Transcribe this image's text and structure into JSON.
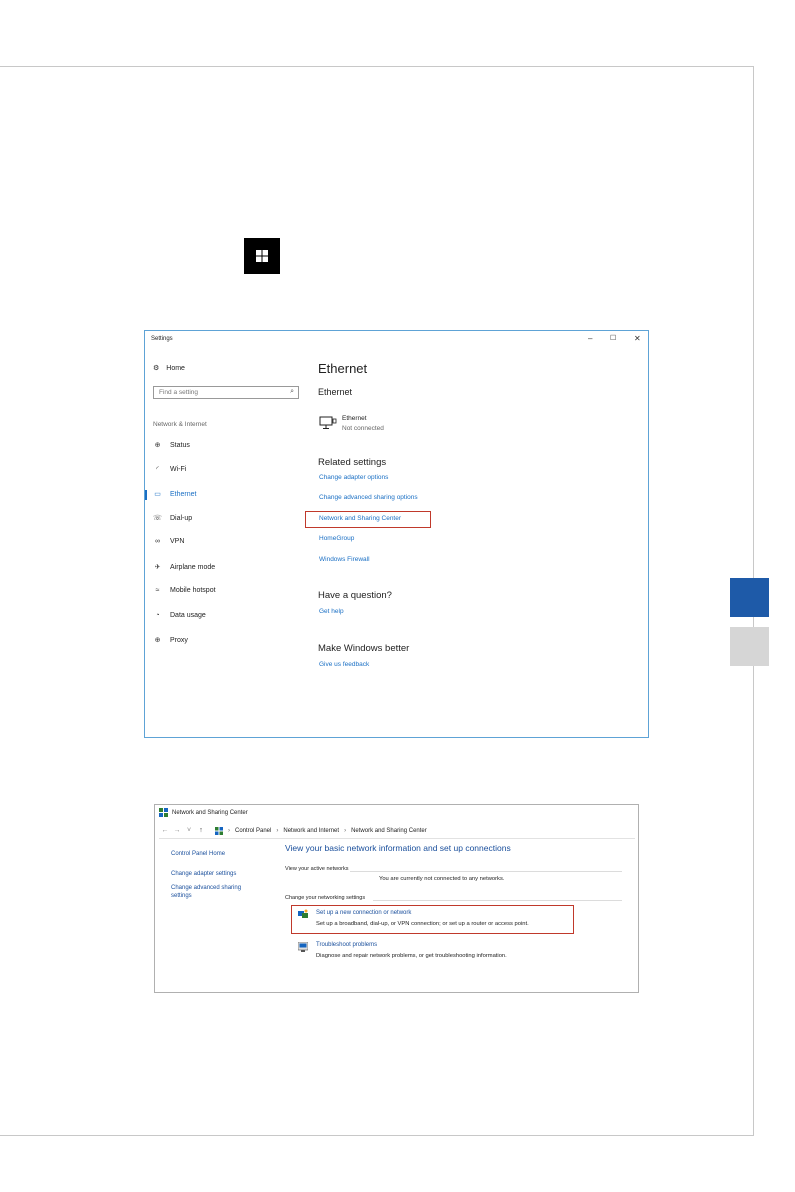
{
  "settings_window": {
    "title": "Settings",
    "controls": {
      "minimize": "–",
      "maximize": "☐",
      "close": "✕"
    },
    "home_label": "Home",
    "search_placeholder": "Find a setting",
    "section_label": "Network & Internet",
    "nav_items": [
      {
        "label": "Status",
        "icon": "status-icon"
      },
      {
        "label": "Wi-Fi",
        "icon": "wifi-icon"
      },
      {
        "label": "Ethernet",
        "icon": "ethernet-icon",
        "active": true
      },
      {
        "label": "Dial-up",
        "icon": "dialup-icon"
      },
      {
        "label": "VPN",
        "icon": "vpn-icon"
      },
      {
        "label": "Airplane mode",
        "icon": "airplane-icon"
      },
      {
        "label": "Mobile hotspot",
        "icon": "hotspot-icon"
      },
      {
        "label": "Data usage",
        "icon": "data-usage-icon"
      },
      {
        "label": "Proxy",
        "icon": "proxy-icon"
      }
    ],
    "main": {
      "heading": "Ethernet",
      "subheading": "Ethernet",
      "adapter_name": "Ethernet",
      "adapter_status": "Not connected",
      "related_heading": "Related settings",
      "related_links": [
        "Change adapter options",
        "Change advanced sharing options",
        "Network and Sharing Center",
        "HomeGroup",
        "Windows Firewall"
      ],
      "question_heading": "Have a question?",
      "question_link": "Get help",
      "better_heading": "Make Windows better",
      "better_link": "Give us feedback"
    },
    "accent_color": "#1a6fc4",
    "highlight_color": "#c0392b"
  },
  "nsc_window": {
    "title": "Network and Sharing Center",
    "breadcrumb": [
      "Control Panel",
      "Network and Internet",
      "Network and Sharing Center"
    ],
    "left_links": [
      "Control Panel Home",
      "Change adapter settings",
      "Change advanced sharing settings"
    ],
    "headline": "View your basic network information and set up connections",
    "active_networks_label": "View your active networks",
    "not_connected_text": "You are currently not connected to any networks.",
    "change_settings_label": "Change your networking settings",
    "tasks": [
      {
        "title": "Set up a new connection or network",
        "desc": "Set up a broadband, dial-up, or VPN connection; or set up a router or access point."
      },
      {
        "title": "Troubleshoot problems",
        "desc": "Diagnose and repair network problems, or get troubleshooting information."
      }
    ]
  }
}
